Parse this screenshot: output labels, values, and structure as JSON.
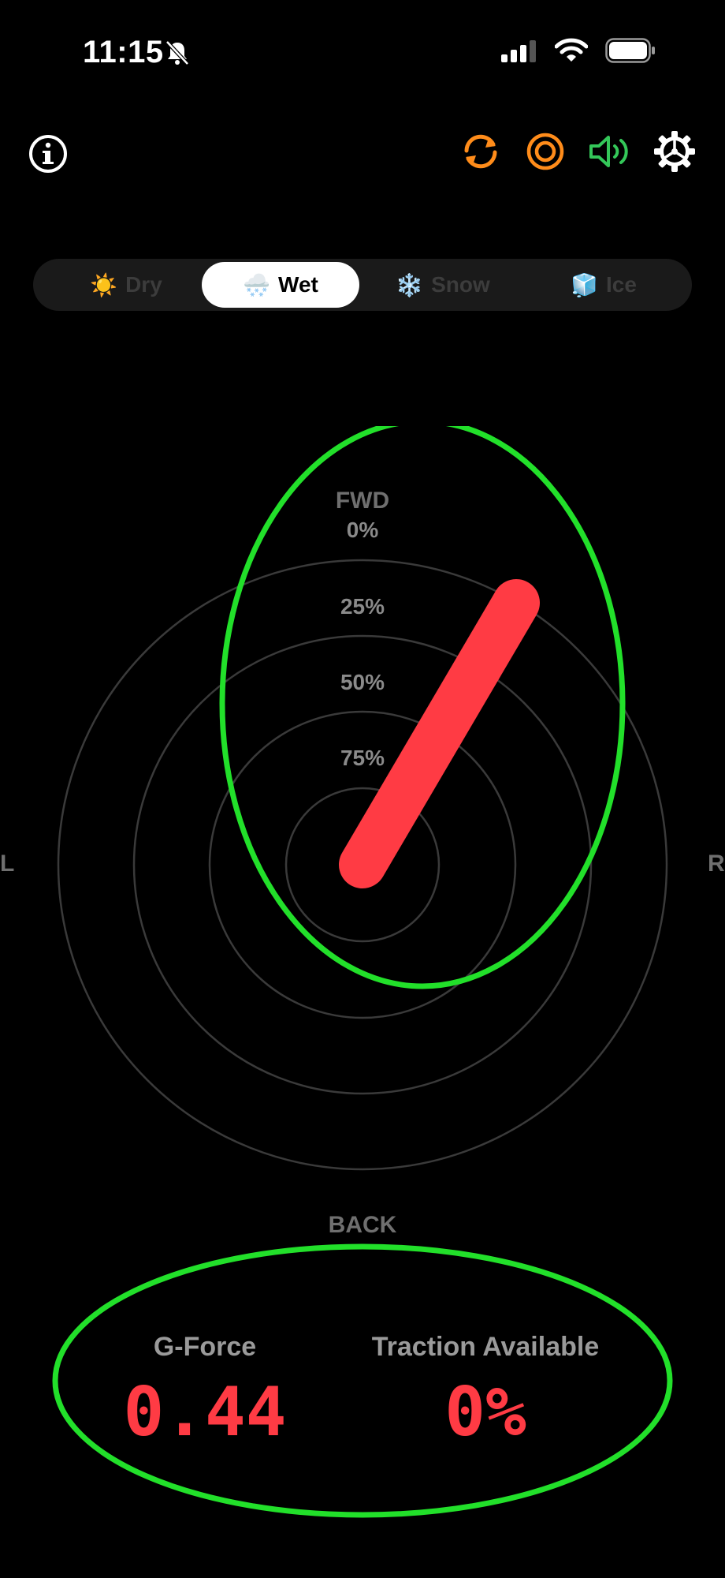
{
  "status_bar": {
    "time": "11:15"
  },
  "toolbar": {
    "info_icon": "info-icon",
    "right_icons": [
      "refresh-icon",
      "target-icon",
      "speaker-icon",
      "gear-icon"
    ],
    "colors": {
      "refresh": "#ff8c1a",
      "target": "#ff8c1a",
      "speaker": "#34c759",
      "gear": "#ffffff"
    }
  },
  "surfaces": [
    {
      "emoji": "☀️",
      "label": "Dry",
      "selected": false
    },
    {
      "emoji": "🌨️",
      "label": "Wet",
      "selected": true
    },
    {
      "emoji": "❄️",
      "label": "Snow",
      "selected": false
    },
    {
      "emoji": "🧊",
      "label": "Ice",
      "selected": false
    }
  ],
  "gauge": {
    "fwd_label": "FWD",
    "back_label": "BACK",
    "left_label": "L",
    "right_label": "R",
    "ring_labels": [
      "0%",
      "25%",
      "50%",
      "75%"
    ],
    "needle_color": "#ff3b44",
    "highlight_color": "#22e02a"
  },
  "readouts": {
    "gforce_title": "G-Force",
    "gforce_value": "0.44",
    "traction_title": "Traction Available",
    "traction_value": "0%"
  }
}
